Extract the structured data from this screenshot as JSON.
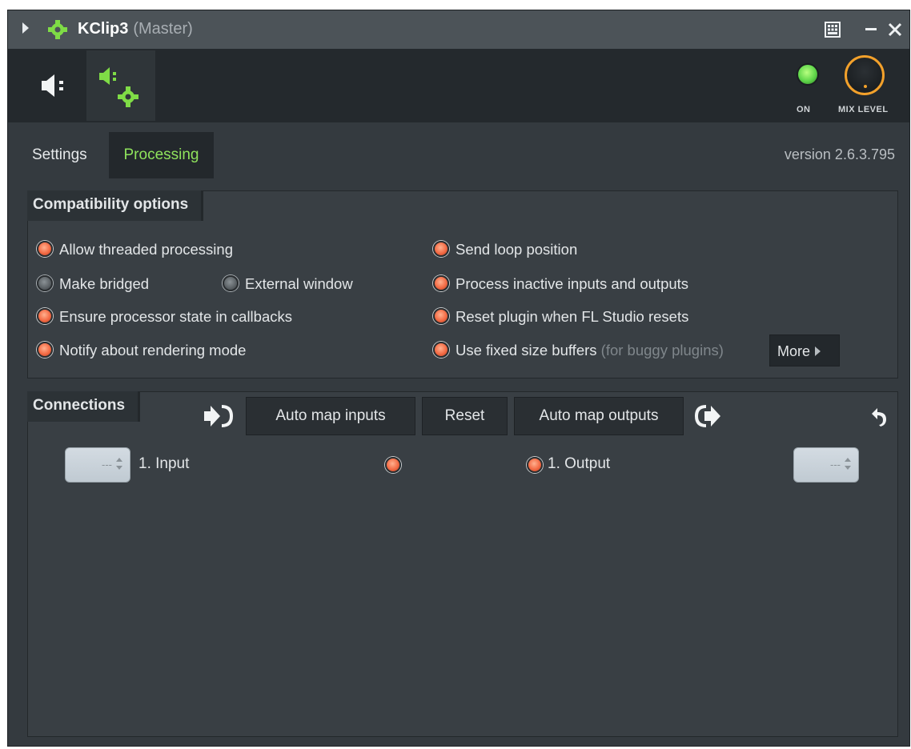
{
  "titlebar": {
    "plugin_name": "KClip3",
    "target": "(Master)"
  },
  "header": {
    "on_label": "ON",
    "mix_label": "MIX LEVEL",
    "on_state": true,
    "accent_color": "#f3a12b",
    "led_color": "#5fd64a"
  },
  "tabs": {
    "settings": "Settings",
    "processing": "Processing",
    "active": "Processing"
  },
  "version": "version 2.6.3.795",
  "compatibility": {
    "title": "Compatibility options",
    "options": [
      {
        "label": "Allow threaded processing",
        "on": true
      },
      {
        "label": "Make bridged",
        "on": false
      },
      {
        "label": "External window",
        "on": false
      },
      {
        "label": "Ensure processor state in callbacks",
        "on": true
      },
      {
        "label": "Notify about rendering mode",
        "on": true
      },
      {
        "label": "Send loop position",
        "on": true
      },
      {
        "label": "Process inactive inputs and outputs",
        "on": true
      },
      {
        "label": "Reset plugin when FL Studio resets",
        "on": true
      },
      {
        "label": "Use fixed size buffers",
        "on": true,
        "note": "(for buggy plugins)"
      }
    ],
    "more": "More"
  },
  "connections": {
    "title": "Connections",
    "auto_map_inputs": "Auto map inputs",
    "reset": "Reset",
    "auto_map_outputs": "Auto map outputs",
    "input": {
      "label": "1. Input",
      "value": "---"
    },
    "output": {
      "label": "1. Output",
      "value": "---"
    }
  }
}
